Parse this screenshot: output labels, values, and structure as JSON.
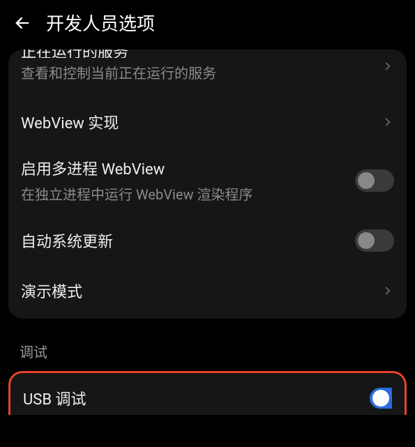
{
  "header": {
    "title": "开发人员选项"
  },
  "card1": {
    "running_services": {
      "title_obscured": "正在运行的服务",
      "subtitle": "查看和控制当前正在运行的服务"
    },
    "webview_impl": {
      "title": "WebView 实现"
    },
    "multi_process_webview": {
      "title": "启用多进程 WebView",
      "subtitle": "在独立进程中运行 WebView 渲染程序",
      "enabled": false
    },
    "auto_system_update": {
      "title": "自动系统更新",
      "enabled": false
    },
    "demo_mode": {
      "title": "演示模式"
    }
  },
  "section_debug": {
    "label": "调试"
  },
  "debug_card": {
    "usb_debug": {
      "title": "USB 调试",
      "enabled": true
    }
  }
}
